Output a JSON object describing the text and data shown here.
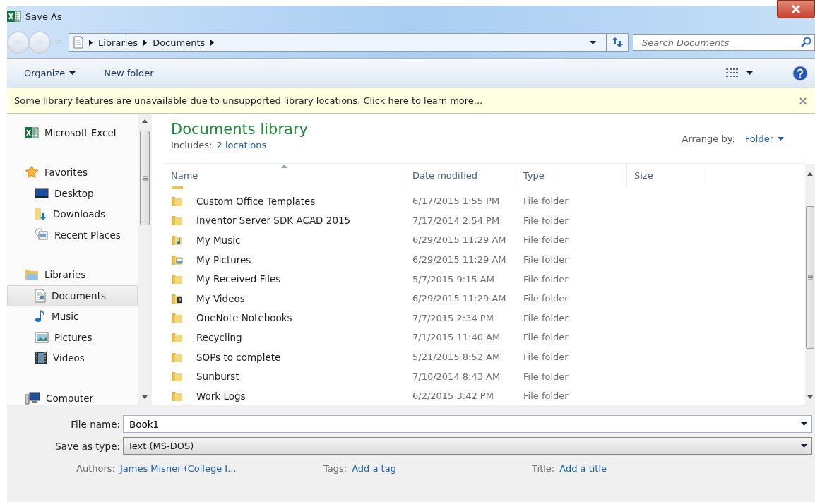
{
  "window": {
    "title": "Save As"
  },
  "address": {
    "crumbs": [
      "Libraries",
      "Documents"
    ]
  },
  "search": {
    "placeholder": "Search Documents"
  },
  "toolbar": {
    "buttons": [
      "Organize",
      "New folder"
    ]
  },
  "info_bar": {
    "message": "Some library features are unavailable due to unsupported library locations. Click here to learn more..."
  },
  "sidebar": {
    "items": [
      {
        "label": "Microsoft Excel",
        "kind": "group",
        "selected": false
      },
      {
        "label": "Favorites",
        "kind": "group",
        "selected": false
      },
      {
        "label": "Desktop",
        "kind": "item",
        "selected": false
      },
      {
        "label": "Downloads",
        "kind": "item",
        "selected": false
      },
      {
        "label": "Recent Places",
        "kind": "item",
        "selected": false
      },
      {
        "label": "Libraries",
        "kind": "group",
        "selected": false
      },
      {
        "label": "Documents",
        "kind": "item",
        "selected": true
      },
      {
        "label": "Music",
        "kind": "item",
        "selected": false
      },
      {
        "label": "Pictures",
        "kind": "item",
        "selected": false
      },
      {
        "label": "Videos",
        "kind": "item",
        "selected": false
      },
      {
        "label": "Computer",
        "kind": "group",
        "selected": false
      }
    ]
  },
  "library": {
    "title": "Documents library",
    "includes_label": "Includes:",
    "includes_link": "2 locations",
    "arrange_label": "Arrange by:",
    "arrange_value": "Folder"
  },
  "table": {
    "columns": [
      "Name",
      "Date modified",
      "Type",
      "Size"
    ],
    "rows": [
      {
        "name": "Custom Office Templates",
        "date": "6/17/2015 1:55 PM",
        "type": "File folder"
      },
      {
        "name": "Inventor Server SDK ACAD 2015",
        "date": "7/17/2014 2:54 PM",
        "type": "File folder"
      },
      {
        "name": "My Music",
        "date": "6/29/2015 11:29 AM",
        "type": "File folder"
      },
      {
        "name": "My Pictures",
        "date": "6/29/2015 11:29 AM",
        "type": "File folder"
      },
      {
        "name": "My Received Files",
        "date": "5/7/2015 9:15 AM",
        "type": "File folder"
      },
      {
        "name": "My Videos",
        "date": "6/29/2015 11:29 AM",
        "type": "File folder"
      },
      {
        "name": "OneNote Notebooks",
        "date": "7/7/2015 2:34 PM",
        "type": "File folder"
      },
      {
        "name": "Recycling",
        "date": "7/1/2015 11:40 AM",
        "type": "File folder"
      },
      {
        "name": "SOPs to complete",
        "date": "5/21/2015 8:52 AM",
        "type": "File folder"
      },
      {
        "name": "Sunburst",
        "date": "7/10/2014 8:43 AM",
        "type": "File folder"
      },
      {
        "name": "Work Logs",
        "date": "6/2/2015 3:42 PM",
        "type": "File folder"
      }
    ]
  },
  "form": {
    "file_name_label": "File name:",
    "file_name": "Book1",
    "type_label": "Save as type:",
    "type_value": "Text (MS-DOS)"
  },
  "metadata": [
    {
      "label": "Authors:",
      "value": "James Misner (College I..."
    },
    {
      "label": "Tags:",
      "value": "Add a tag"
    },
    {
      "label": "Title:",
      "value": "Add a title"
    }
  ]
}
